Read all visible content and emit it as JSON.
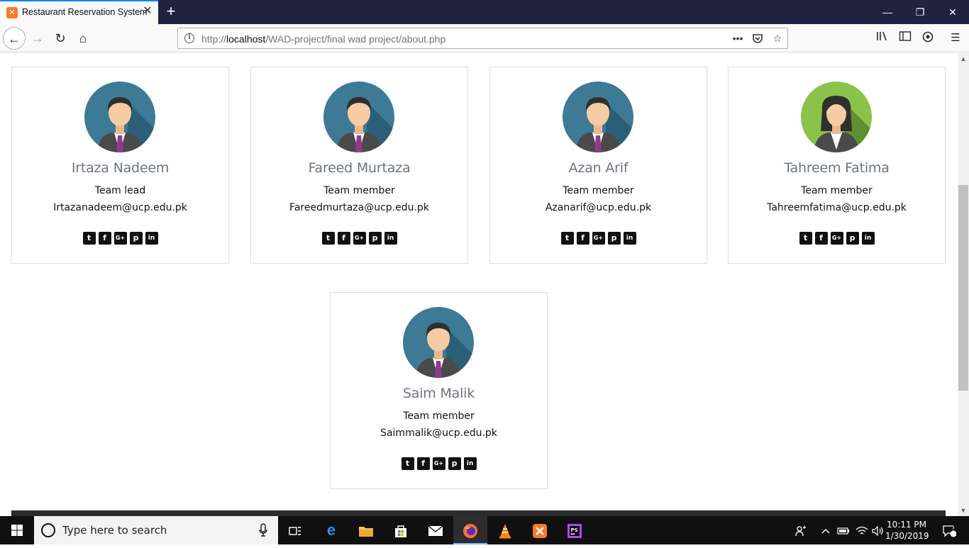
{
  "browser": {
    "tab_title": "Restaurant Reservation System",
    "tab_favicon": "xampp-icon",
    "url_prefix": "http://",
    "url_host": "localhost",
    "url_path": "/WAD-project/final wad project/about.php"
  },
  "team": [
    {
      "name": "Irtaza Nadeem",
      "role": "Team lead",
      "email": "Irtazanadeem@ucp.edu.pk",
      "avatar": "male-avatar"
    },
    {
      "name": "Fareed Murtaza",
      "role": "Team member",
      "email": "Fareedmurtaza@ucp.edu.pk",
      "avatar": "male-avatar"
    },
    {
      "name": "Azan Arif",
      "role": "Team member",
      "email": "Azanarif@ucp.edu.pk",
      "avatar": "male-avatar"
    },
    {
      "name": "Tahreem Fatima",
      "role": "Team member",
      "email": "Tahreemfatima@ucp.edu.pk",
      "avatar": "female-avatar"
    },
    {
      "name": "Saim Malik",
      "role": "Team member",
      "email": "Saimmalik@ucp.edu.pk",
      "avatar": "male-avatar"
    }
  ],
  "social_icons": [
    "twitter-icon",
    "facebook-icon",
    "google-plus-icon",
    "pinterest-icon",
    "linkedin-icon"
  ],
  "social_glyphs": {
    "twitter": "t",
    "facebook": "f",
    "google_plus": "G+",
    "pinterest": "p",
    "linkedin": "in"
  },
  "taskbar": {
    "search_placeholder": "Type here to search",
    "clock_time": "10:11 PM",
    "clock_date": "1/30/2019",
    "notification_count": "2"
  },
  "colors": {
    "male_avatar_bg": "#3d7a96",
    "female_avatar_bg": "#8bc34a",
    "tab_accent": "#0a84ff",
    "titlebar": "#202340"
  }
}
